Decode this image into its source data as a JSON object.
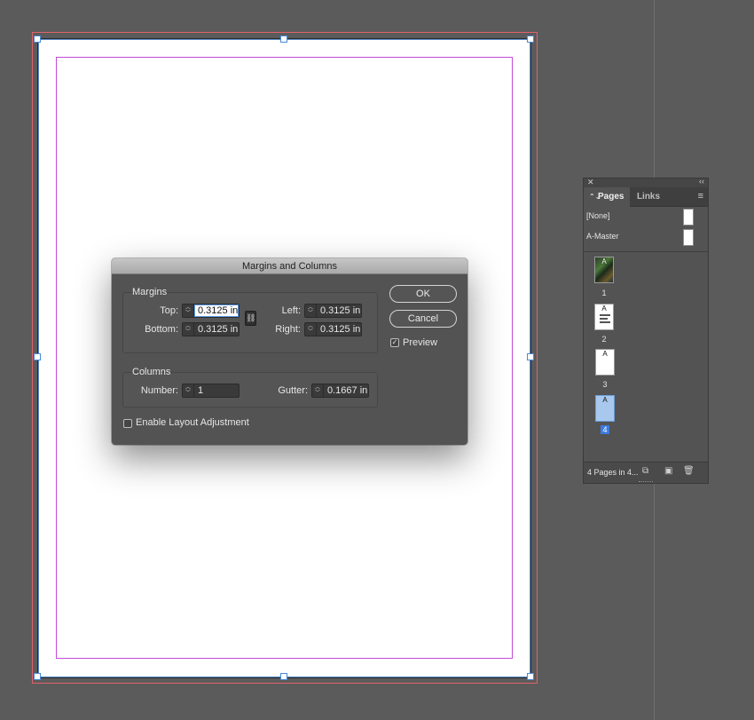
{
  "dialog": {
    "title": "Margins and Columns",
    "margins": {
      "group_label": "Margins",
      "top_label": "Top:",
      "top_value": "0.3125 in",
      "bottom_label": "Bottom:",
      "bottom_value": "0.3125 in",
      "left_label": "Left:",
      "left_value": "0.3125 in",
      "right_label": "Right:",
      "right_value": "0.3125 in"
    },
    "columns": {
      "group_label": "Columns",
      "number_label": "Number:",
      "number_value": "1",
      "gutter_label": "Gutter:",
      "gutter_value": "0.1667 in"
    },
    "enable_layout_adjustment": {
      "label": "Enable Layout Adjustment",
      "checked": false
    },
    "ok_label": "OK",
    "cancel_label": "Cancel",
    "preview": {
      "label": "Preview",
      "checked": true
    }
  },
  "pages_panel": {
    "tabs": [
      {
        "label": "Pages",
        "active": true,
        "glyph": "⌃⌄"
      },
      {
        "label": "Links",
        "active": false
      }
    ],
    "masters": [
      {
        "label": "[None]"
      },
      {
        "label": "A-Master"
      }
    ],
    "pages": [
      {
        "number": "1",
        "prefix": "A",
        "style": "photo",
        "selected": false
      },
      {
        "number": "2",
        "prefix": "A",
        "style": "text",
        "selected": false
      },
      {
        "number": "3",
        "prefix": "A",
        "style": "blank",
        "selected": false
      },
      {
        "number": "4",
        "prefix": "A",
        "style": "blank",
        "selected": true
      }
    ],
    "footer_status": "4 Pages in 4...",
    "icons": [
      "close-icon",
      "collapse-icon",
      "panel-menu-icon",
      "edit-page-size-icon",
      "new-page-icon",
      "trash-icon"
    ]
  },
  "colors": {
    "canvas": "#5b5b5b",
    "bleed_guide": "#e0626a",
    "margin_guide": "#c24bd6",
    "selection": "#4b8ad6",
    "selected_page_number": "#3c7be0"
  }
}
